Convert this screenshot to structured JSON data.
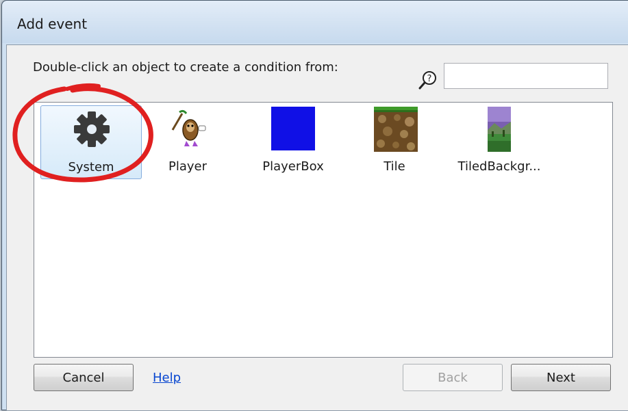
{
  "window": {
    "title": "Add event"
  },
  "dialog": {
    "prompt": "Double-click an object to create a condition from:",
    "search": {
      "value": "",
      "placeholder": "",
      "icon": "search-help-icon"
    }
  },
  "objects": [
    {
      "label": "System",
      "icon": "gear-icon",
      "selected": true
    },
    {
      "label": "Player",
      "icon": "player-sprite-icon",
      "selected": false
    },
    {
      "label": "PlayerBox",
      "icon": "blue-square-icon",
      "selected": false
    },
    {
      "label": "Tile",
      "icon": "dirt-tile-icon",
      "selected": false
    },
    {
      "label": "TiledBackgr...",
      "icon": "landscape-icon",
      "selected": false
    }
  ],
  "buttons": {
    "cancel": "Cancel",
    "help": "Help",
    "back": "Back",
    "back_disabled": true,
    "next": "Next"
  },
  "colors": {
    "annotation": "#e02020",
    "selection": "#d6eaf9",
    "link": "#0645d0"
  }
}
